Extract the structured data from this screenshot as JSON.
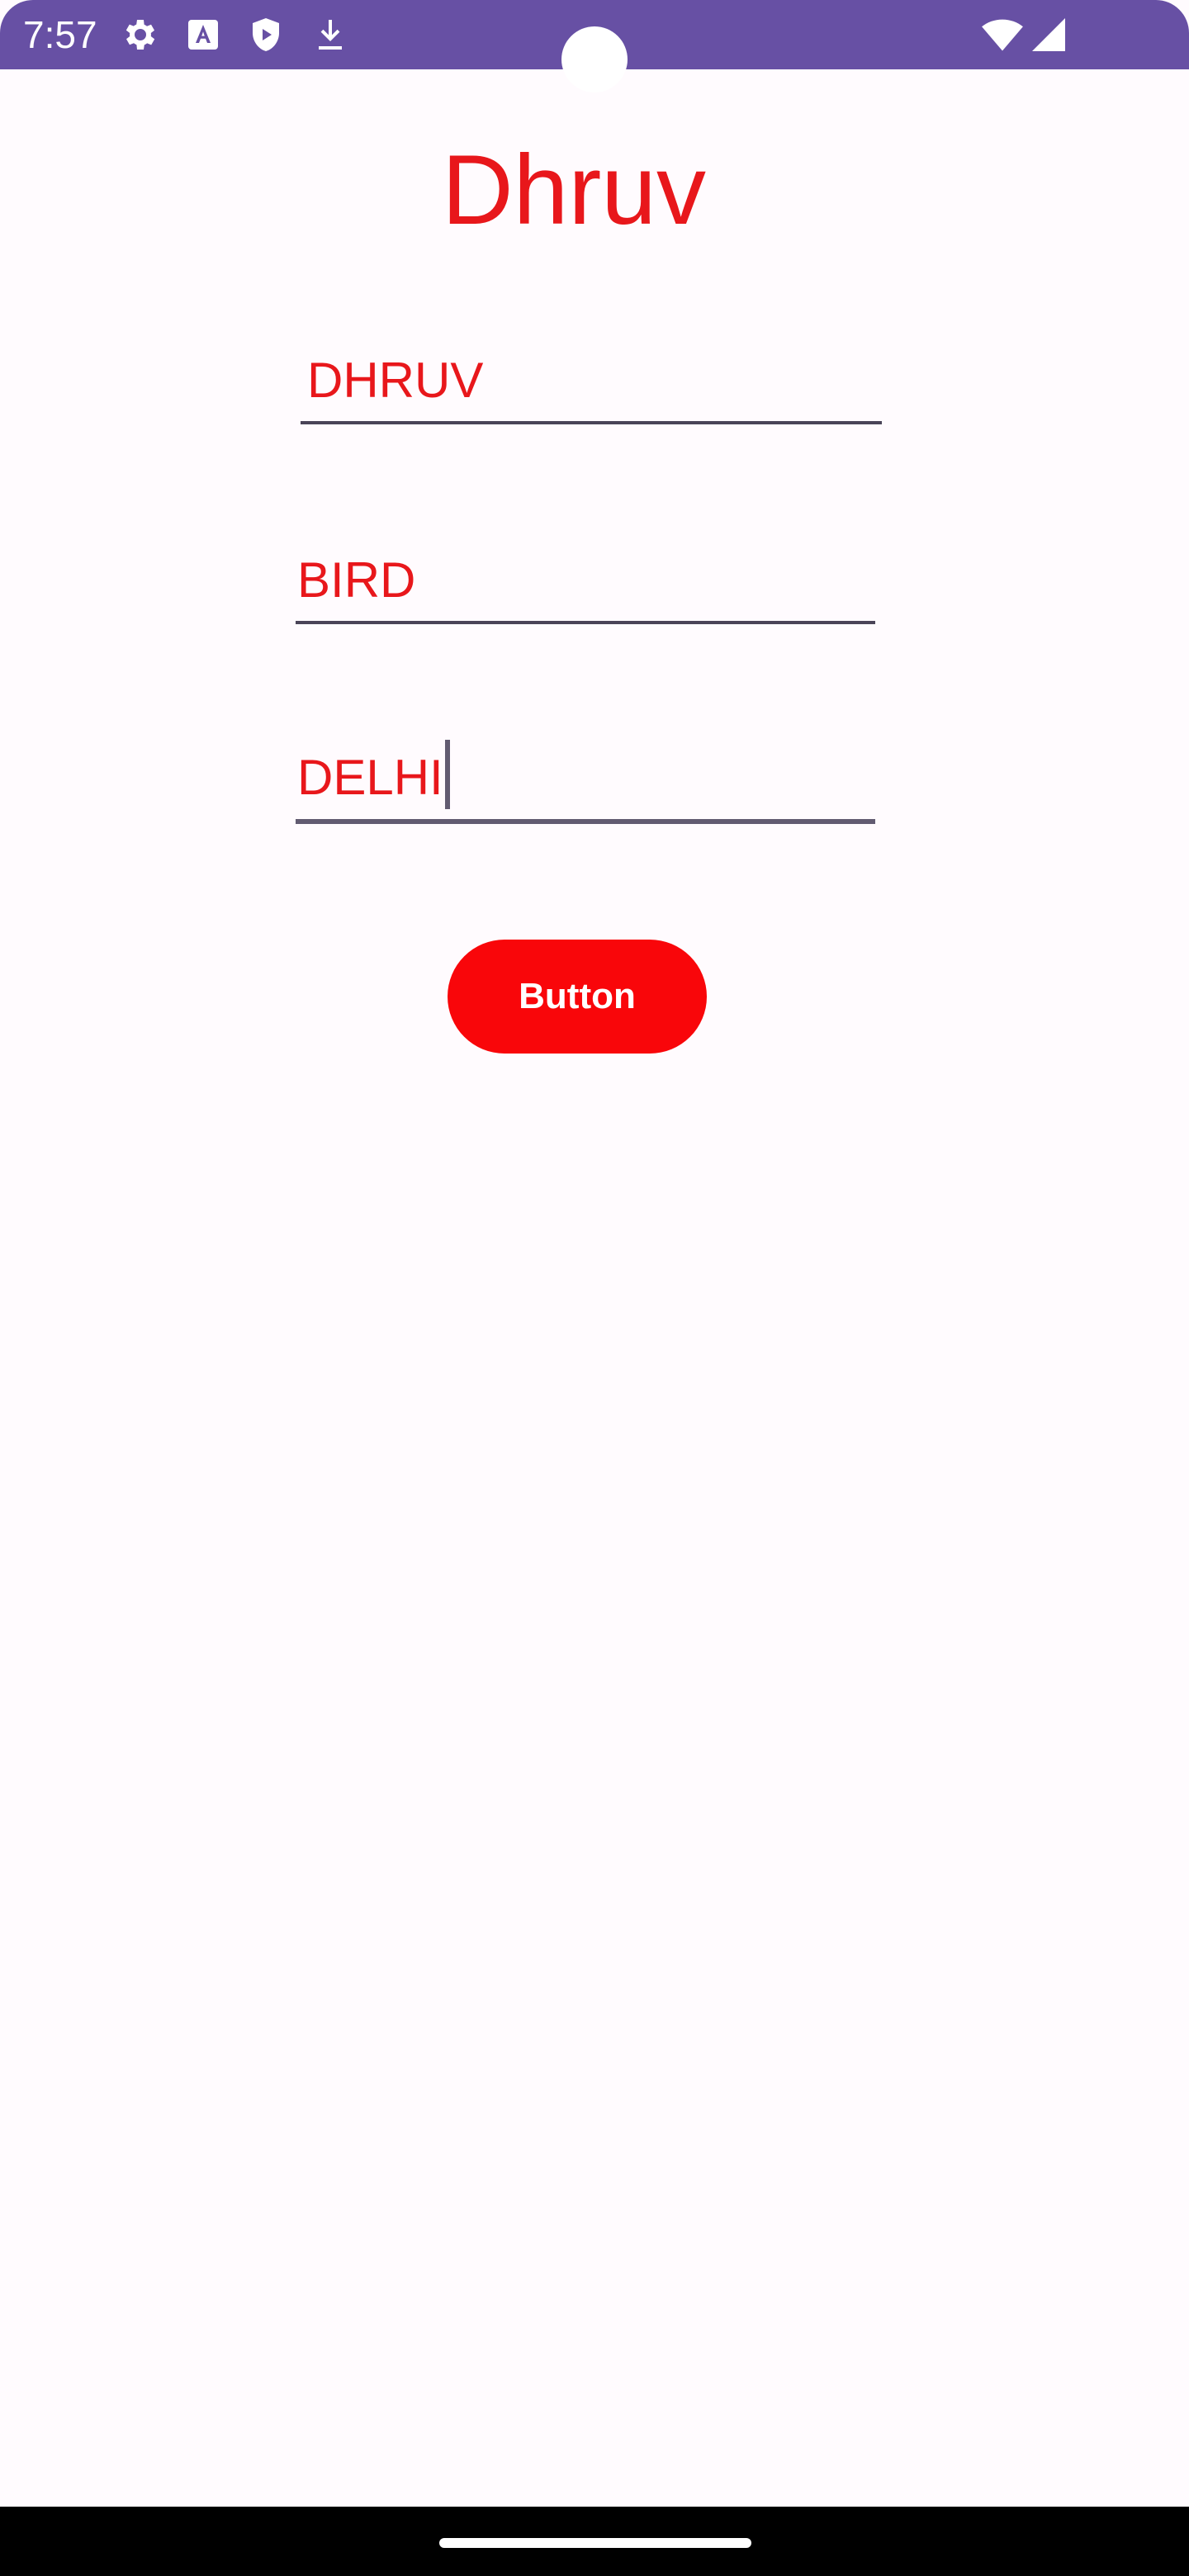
{
  "status_bar": {
    "time": "7:57",
    "left_icons": [
      "settings-icon",
      "text-a-icon",
      "shield-play-icon",
      "download-icon"
    ],
    "right_icons": [
      "wifi-icon",
      "signal-icon"
    ],
    "color": "#6750a4"
  },
  "app": {
    "title": "Dhruv",
    "accent_color": "#e8171b"
  },
  "form": {
    "field1": {
      "value": "DHRUV"
    },
    "field2": {
      "value": "BIRD"
    },
    "field3": {
      "value": "DELHI",
      "focused": true
    }
  },
  "button": {
    "label": "Button",
    "color": "#f9060a"
  },
  "nav_bar": {
    "handle": "home-handle"
  }
}
